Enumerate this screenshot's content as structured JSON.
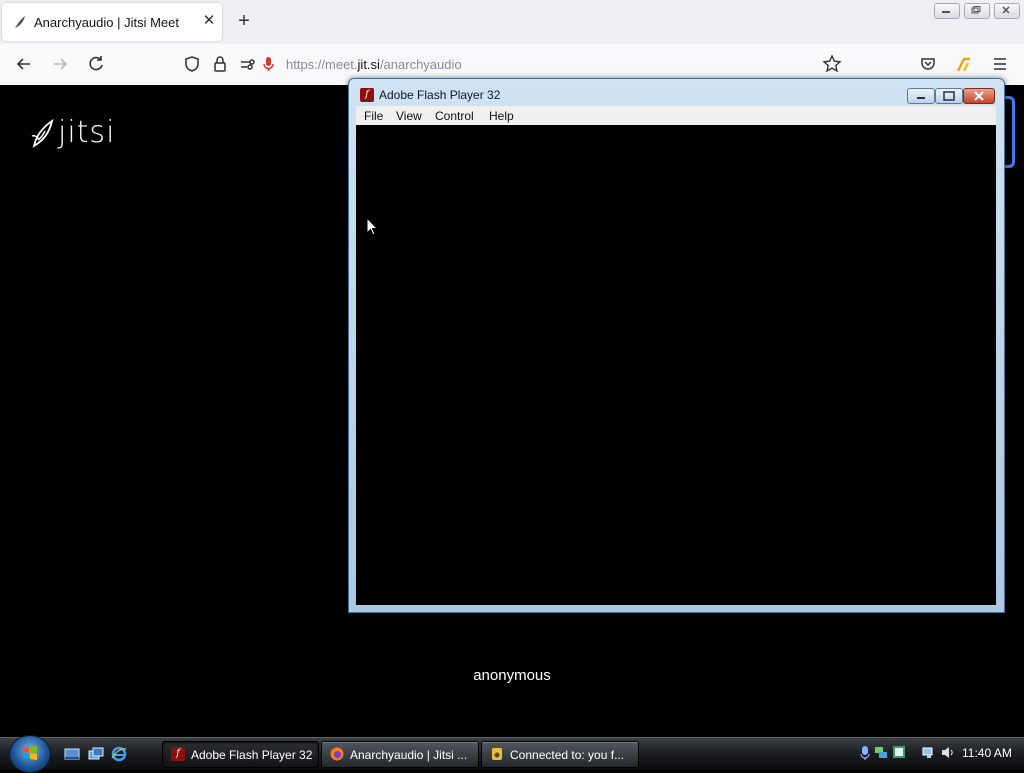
{
  "browser": {
    "tab": {
      "title": "Anarchyaudio | Jitsi Meet",
      "favicon": "jitsi-feather-icon"
    },
    "url": {
      "prefix": "https://meet.",
      "domain": "jit.si",
      "path": "/anarchyaudio"
    }
  },
  "page": {
    "logo_text": "jitsi",
    "participant_name": "anonymous"
  },
  "flash_window": {
    "title": "Adobe Flash Player 32",
    "menu": [
      "File",
      "View",
      "Control",
      "Help"
    ]
  },
  "taskbar": {
    "buttons": [
      {
        "label": "Adobe Flash Player 32",
        "icon": "flash-icon",
        "active": true
      },
      {
        "label": "Anarchyaudio | Jitsi ...",
        "icon": "firefox-icon",
        "active": false
      },
      {
        "label": "Connected to: you f...",
        "icon": "audio-app-icon",
        "active": false
      }
    ],
    "clock": "11:40 AM"
  },
  "colors": {
    "accent_blue": "#3d7cf0",
    "flash_red": "#8a0f0f"
  }
}
